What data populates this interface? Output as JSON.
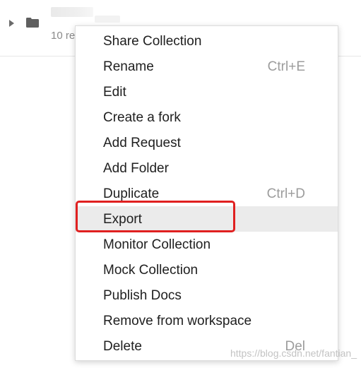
{
  "collection": {
    "request_count_text": "10 re"
  },
  "context_menu": {
    "items": [
      {
        "label": "Share Collection",
        "shortcut": ""
      },
      {
        "label": "Rename",
        "shortcut": "Ctrl+E"
      },
      {
        "label": "Edit",
        "shortcut": ""
      },
      {
        "label": "Create a fork",
        "shortcut": ""
      },
      {
        "label": "Add Request",
        "shortcut": ""
      },
      {
        "label": "Add Folder",
        "shortcut": ""
      },
      {
        "label": "Duplicate",
        "shortcut": "Ctrl+D"
      },
      {
        "label": "Export",
        "shortcut": ""
      },
      {
        "label": "Monitor Collection",
        "shortcut": ""
      },
      {
        "label": "Mock Collection",
        "shortcut": ""
      },
      {
        "label": "Publish Docs",
        "shortcut": ""
      },
      {
        "label": "Remove from workspace",
        "shortcut": ""
      },
      {
        "label": "Delete",
        "shortcut": "Del"
      }
    ],
    "highlighted_item": "Export",
    "annotation_color": "#e02020"
  },
  "watermark": "https://blog.csdn.net/fantian_"
}
